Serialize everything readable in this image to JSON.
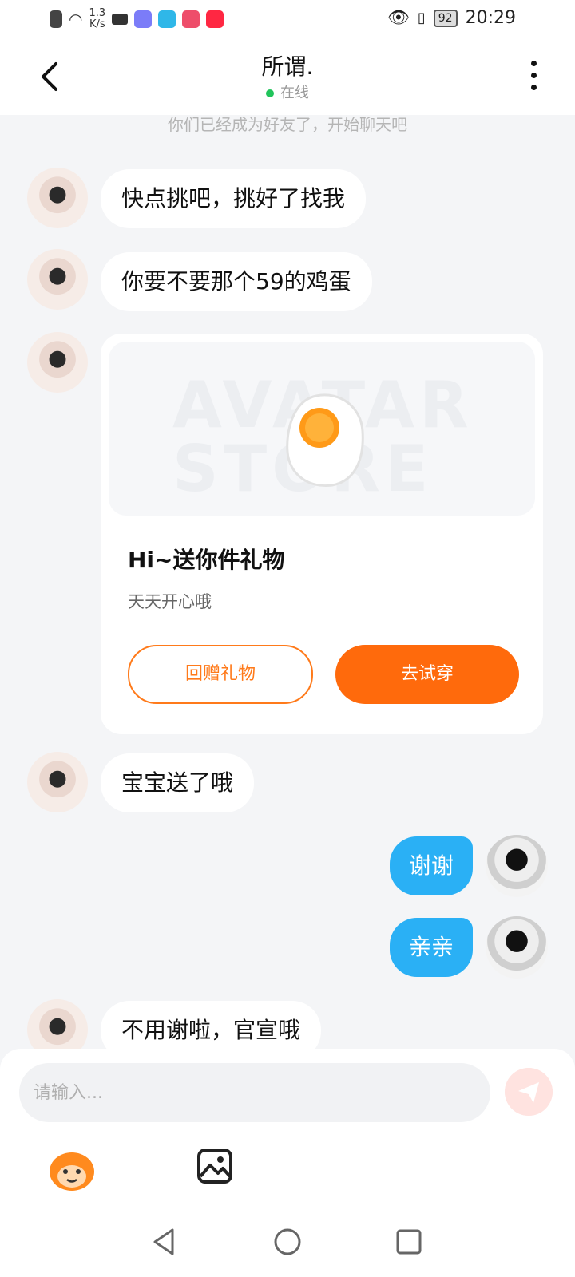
{
  "status_bar": {
    "net_speed_value": "1.3",
    "net_speed_unit": "K/s",
    "battery": "92",
    "time": "20:29"
  },
  "header": {
    "title": "所谓.",
    "presence": "在线"
  },
  "chat": {
    "system_note": "你们已经成为好友了，开始聊天吧",
    "messages": [
      {
        "side": "left",
        "text": "快点挑吧，挑好了找我"
      },
      {
        "side": "left",
        "text": "你要不要那个59的鸡蛋"
      },
      {
        "side": "left",
        "text": "宝宝送了哦"
      },
      {
        "side": "right",
        "text": "谢谢"
      },
      {
        "side": "right",
        "text": "亲亲"
      },
      {
        "side": "left",
        "text": "不用谢啦，官宣哦"
      }
    ],
    "gift_card": {
      "watermark": "AVATAR STORE",
      "title": "Hi~送你件礼物",
      "subtitle": "天天开心哦",
      "return_button": "回赠礼物",
      "try_button": "去试穿"
    }
  },
  "composer": {
    "placeholder": "请输入..."
  },
  "colors": {
    "accent_orange": "#ff6a0c",
    "my_bubble": "#2ab0f5",
    "online_dot": "#21c45b",
    "background": "#f4f5f7"
  },
  "icons": [
    "back-arrow-icon",
    "more-vertical-icon",
    "send-icon",
    "emoji-icon",
    "image-icon",
    "nav-back-icon",
    "nav-home-icon",
    "nav-recents-icon"
  ]
}
